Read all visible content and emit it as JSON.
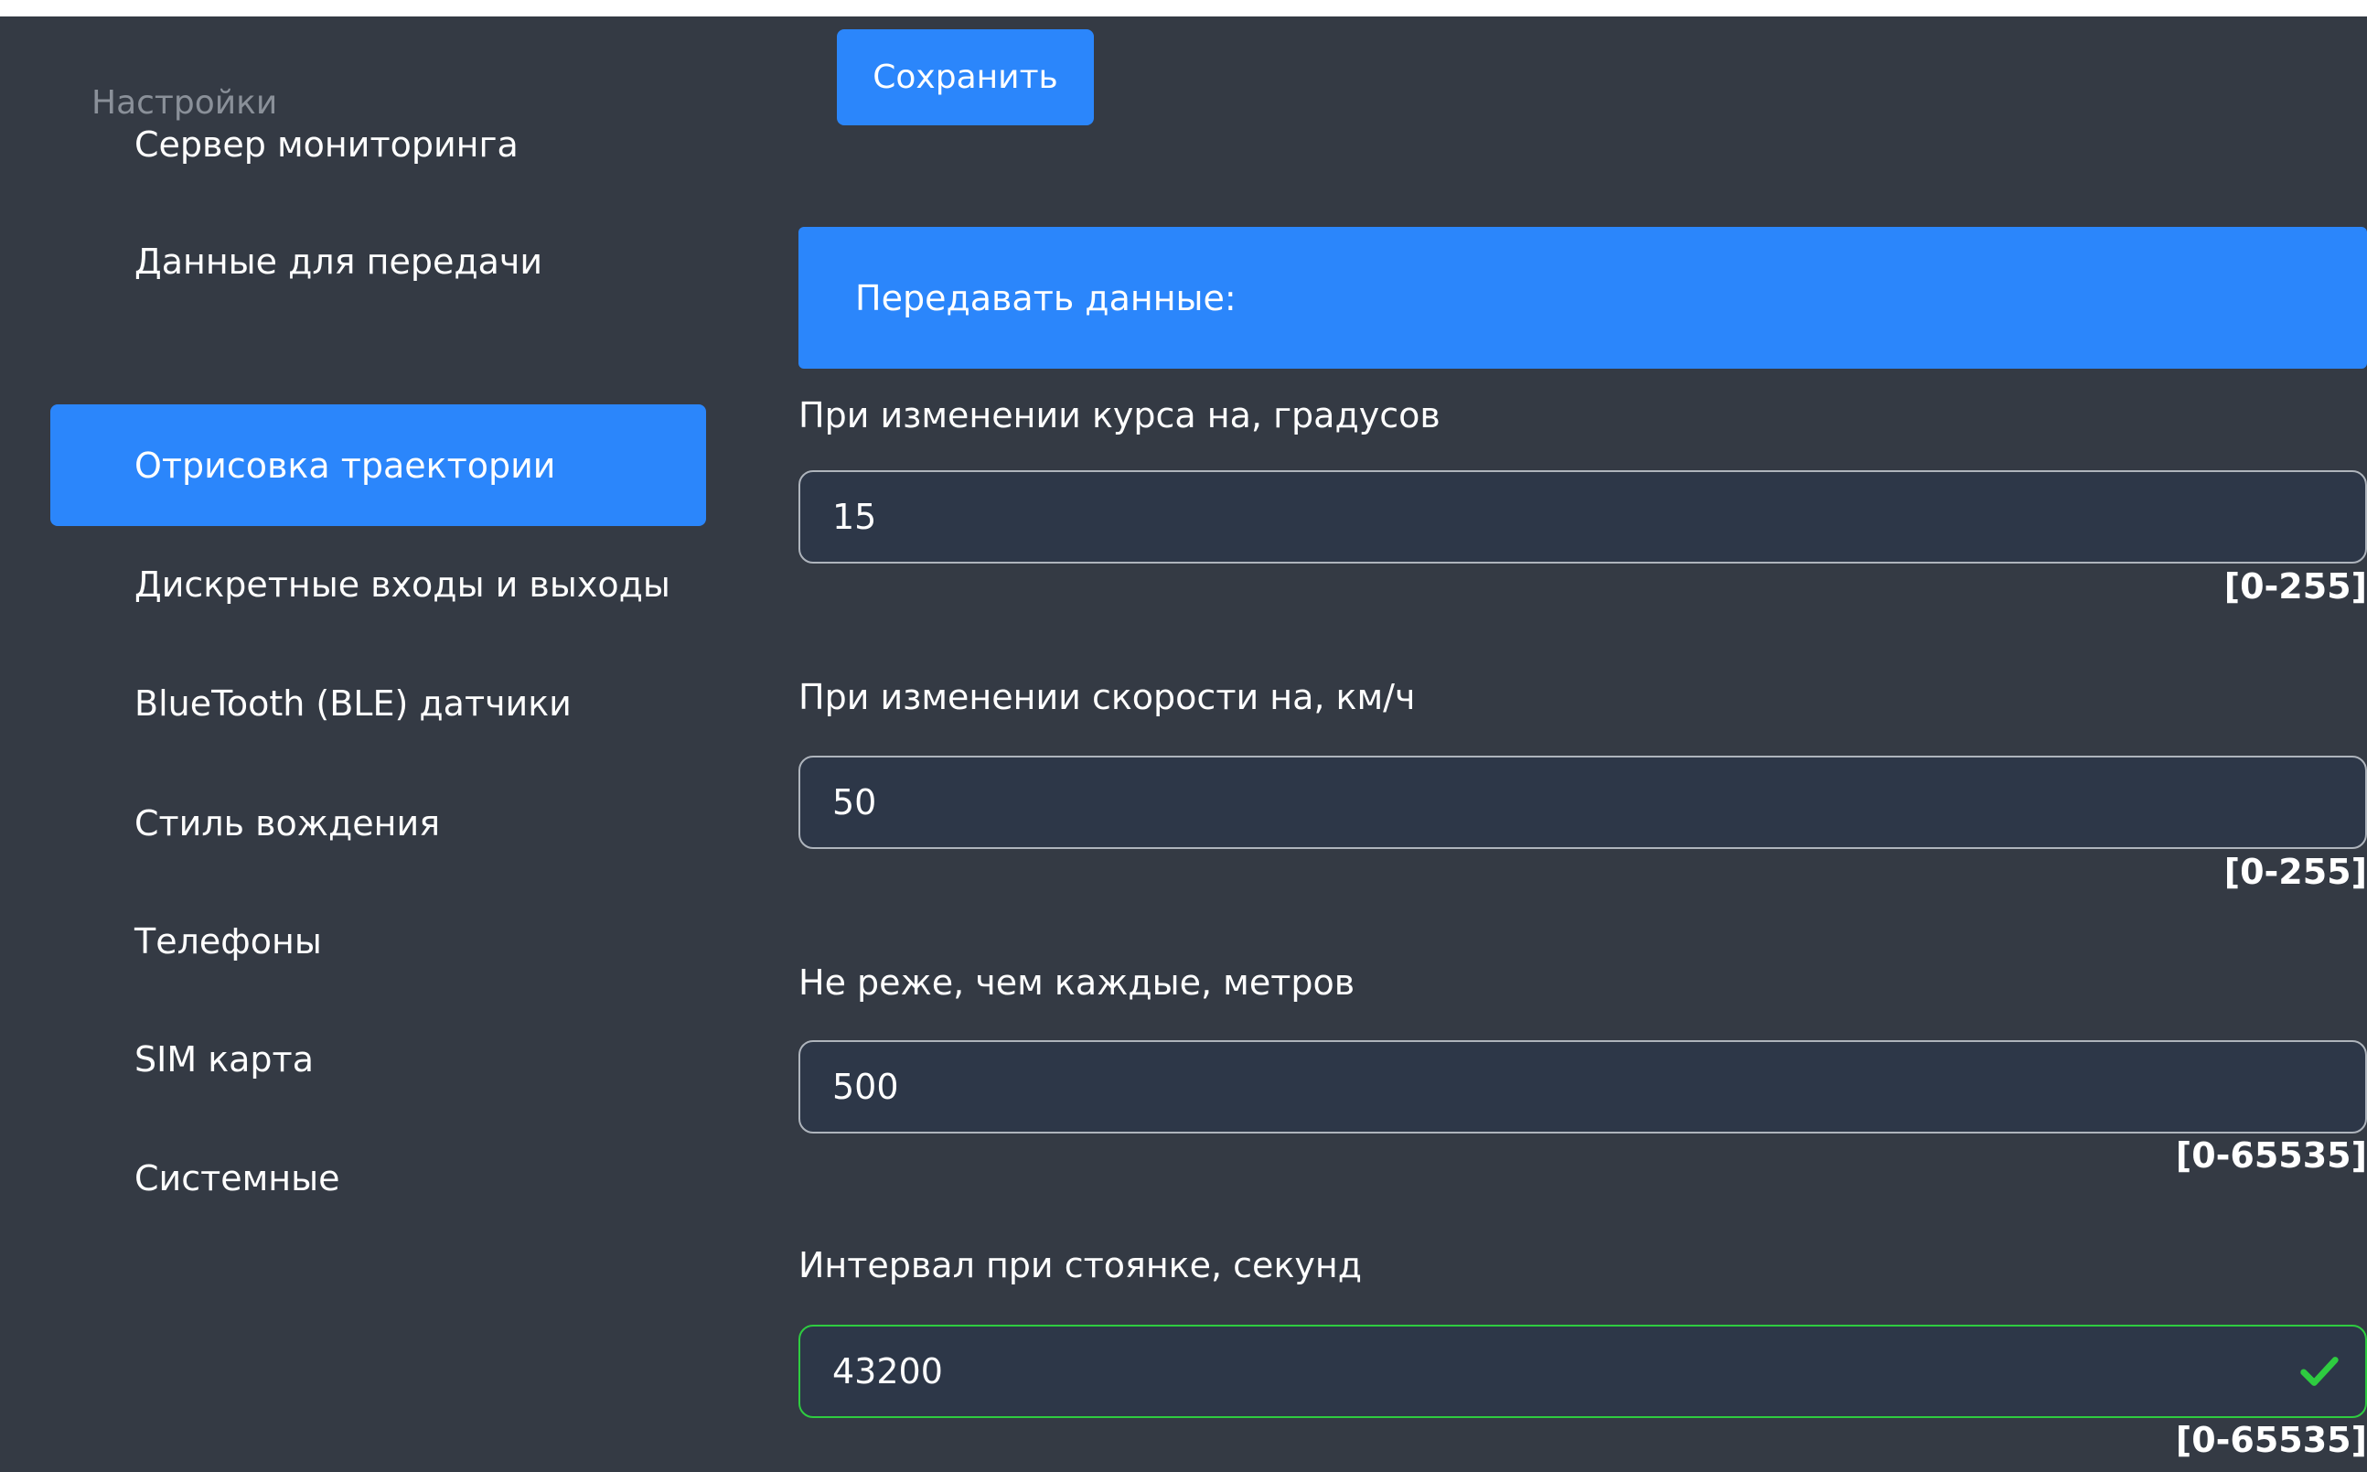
{
  "sidebar": {
    "heading": "Настройки",
    "items": [
      {
        "label": "Сервер мониторинга",
        "active": false
      },
      {
        "label": "Данные для передачи",
        "active": false
      },
      {
        "label": "Отрисовка траектории",
        "active": true
      },
      {
        "label": "Дискретные входы и выходы",
        "active": false
      },
      {
        "label": "BlueTooth (BLE) датчики",
        "active": false
      },
      {
        "label": "Стиль вождения",
        "active": false
      },
      {
        "label": "Телефоны",
        "active": false
      },
      {
        "label": "SIM карта",
        "active": false
      },
      {
        "label": "Системные",
        "active": false
      }
    ]
  },
  "toolbar": {
    "save_label": "Сохранить"
  },
  "section": {
    "title": "Передавать данные:"
  },
  "fields": [
    {
      "label": "При изменении курса на, градусов",
      "value": "15",
      "range": "[0-255]",
      "valid": false
    },
    {
      "label": "При изменении скорости на, км/ч",
      "value": "50",
      "range": "[0-255]",
      "valid": false
    },
    {
      "label": "Не реже, чем каждые, метров",
      "value": "500",
      "range": "[0-65535]",
      "valid": false
    },
    {
      "label": "Интервал при стоянке, секунд",
      "value": "43200",
      "range": "[0-65535]",
      "valid": true
    }
  ],
  "colors": {
    "background": "#343a44",
    "accent": "#2b86fb",
    "input_bg": "#2d3748",
    "valid": "#2ecc40"
  }
}
